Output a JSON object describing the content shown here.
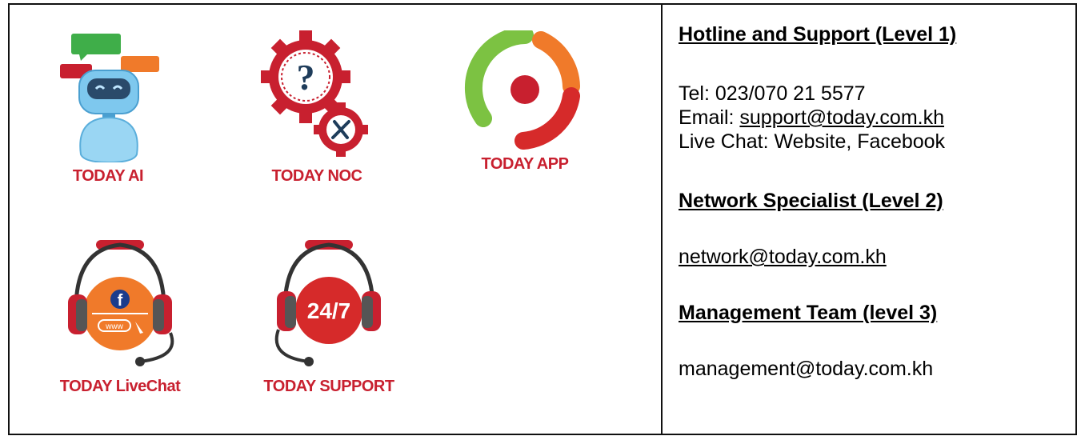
{
  "apps": [
    {
      "name": "TODAY AI",
      "icon": "robot-chat-icon"
    },
    {
      "name": "TODAY NOC",
      "icon": "gears-question-icon"
    },
    {
      "name": "TODAY APP",
      "icon": "app-logo-icon"
    },
    {
      "name": "TODAY LiveChat",
      "icon": "headset-facebook-icon"
    },
    {
      "name": "TODAY SUPPORT",
      "icon": "headset-247-icon"
    }
  ],
  "support": {
    "level1": {
      "heading": "Hotline and Support (Level 1)",
      "tel_label": "Tel: ",
      "tel": "023/070 21 5577",
      "email_label": "Email: ",
      "email": "support@today.com.kh",
      "chat_label": "Live Chat: ",
      "chat": "Website, Facebook"
    },
    "level2": {
      "heading": "Network Specialist (Level 2)",
      "email": "network@today.com.kh"
    },
    "level3": {
      "heading": "Management Team (level 3)",
      "email": "management@today.com.kh"
    }
  },
  "icon_text": {
    "question": "?",
    "facebook": "f",
    "www": "www",
    "support_hours": "24/7"
  },
  "colors": {
    "brand_red": "#c8202f",
    "orange": "#f07a2a",
    "green": "#7cc242",
    "robot_blue": "#7ec8ee"
  }
}
